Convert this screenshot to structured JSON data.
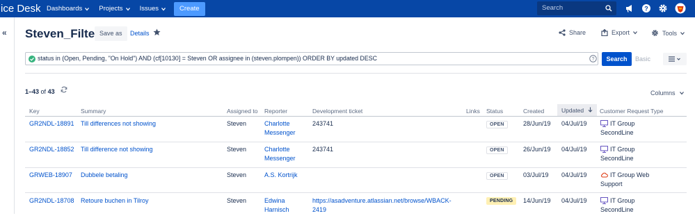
{
  "nav": {
    "brand": "ice Desk",
    "items": [
      {
        "label": "Dashboards"
      },
      {
        "label": "Projects"
      },
      {
        "label": "Issues"
      }
    ],
    "create_label": "Create",
    "search_placeholder": "Search"
  },
  "header": {
    "title": "Steven_Filter",
    "save_as": "Save as",
    "details": "Details",
    "share": "Share",
    "export": "Export",
    "tools": "Tools"
  },
  "jql": {
    "query": "status in (Open, Pending, \"On Hold\") AND (cf[10130] = Steven OR assignee in (steven.plompen)) ORDER BY updated DESC",
    "search_label": "Search",
    "basic_label": "Basic"
  },
  "results": {
    "range": "1–43",
    "of_label": "of",
    "total": "43",
    "columns_label": "Columns"
  },
  "table": {
    "headers": {
      "key": "Key",
      "summary": "Summary",
      "assigned": "Assigned to",
      "reporter": "Reporter",
      "dev_ticket": "Development ticket",
      "links": "Links",
      "status": "Status",
      "created": "Created",
      "updated": "Updated",
      "crt": "Customer Request Type"
    },
    "rows": [
      {
        "key": "GR2NDL-18891",
        "summary": "Till differences not showing",
        "assigned": "Steven",
        "reporter1": "Charlotte",
        "reporter2": "Messenger",
        "dev1": "243741",
        "dev2": "",
        "status": "OPEN",
        "created": "28/Jun/19",
        "updated": "04/Jul/19",
        "crt1": "IT Group",
        "crt2": "SecondLine"
      },
      {
        "key": "GR2NDL-18852",
        "summary": "Till difference not showing",
        "assigned": "Steven",
        "reporter1": "Charlotte",
        "reporter2": "Messenger",
        "dev1": "243741",
        "dev2": "",
        "status": "OPEN",
        "created": "26/Jun/19",
        "updated": "04/Jul/19",
        "crt1": "IT Group",
        "crt2": "SecondLine"
      },
      {
        "key": "GRWEB-18907",
        "summary": "Dubbele betaling",
        "assigned": "Steven",
        "reporter1": "A.S. Kortrijk",
        "reporter2": "",
        "dev1": "",
        "dev2": "",
        "status": "OPEN",
        "created": "03/Jul/19",
        "updated": "04/Jul/19",
        "crt1": "IT Group Web",
        "crt2": "Support"
      },
      {
        "key": "GR2NDL-18708",
        "summary": "Retoure buchen in Tilroy",
        "assigned": "Steven",
        "reporter1": "Edwina",
        "reporter2": "Harnisch",
        "dev1": "https://asadventure.atlassian.net/browse/WBACK-",
        "dev2": "2419",
        "status": "PENDING",
        "created": "14/Jun/19",
        "updated": "04/Jul/19",
        "crt1": "IT Group",
        "crt2": "SecondLine"
      }
    ]
  },
  "colors": {
    "nav_bg": "#0747a6",
    "link": "#0052cc",
    "create_btn": "#4c9aff",
    "pending": "#fff0b3"
  }
}
